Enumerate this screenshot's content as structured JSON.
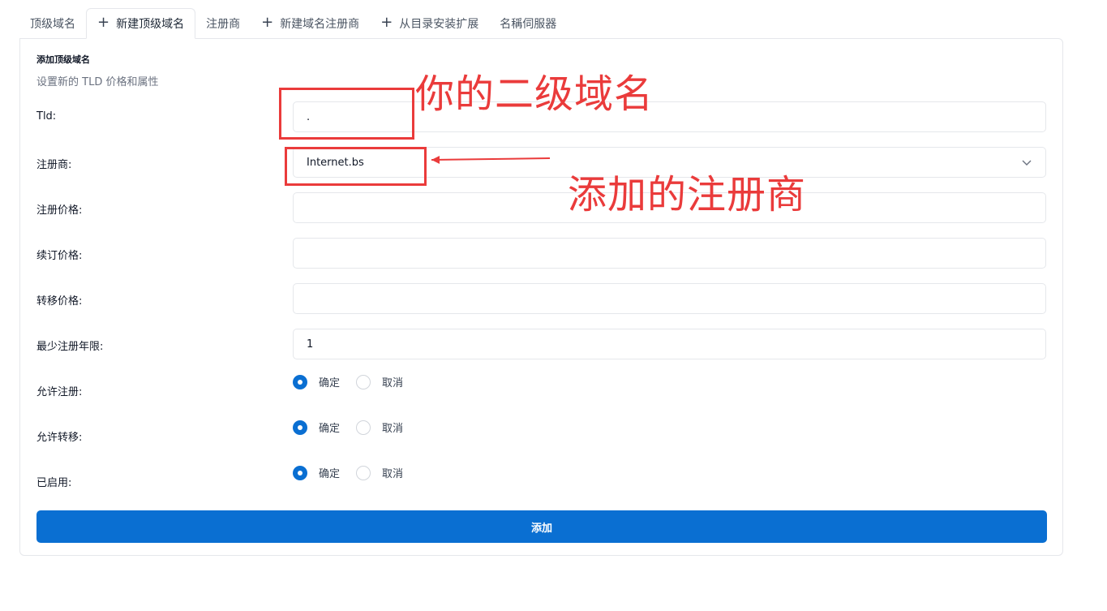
{
  "tabs": [
    {
      "label": "顶级域名",
      "icon": null
    },
    {
      "label": "新建顶级域名",
      "icon": "plus-icon"
    },
    {
      "label": "注册商",
      "icon": null
    },
    {
      "label": "新建域名注册商",
      "icon": "plus-icon"
    },
    {
      "label": "从目录安装扩展",
      "icon": "plus-icon"
    },
    {
      "label": "名稱伺服器",
      "icon": null
    }
  ],
  "form": {
    "title": "添加顶级域名",
    "subtitle": "设置新的 TLD 价格和属性",
    "tld": {
      "label": "Tld:",
      "value": "."
    },
    "registrar": {
      "label": "注册商:",
      "value": "Internet.bs"
    },
    "register_price": {
      "label": "注册价格:",
      "value": ""
    },
    "renew_price": {
      "label": "续订价格:",
      "value": ""
    },
    "transfer_price": {
      "label": "转移价格:",
      "value": ""
    },
    "min_years": {
      "label": "最少注册年限:",
      "value": "1"
    },
    "allow_register": {
      "label": "允许注册:",
      "yes": "确定",
      "no": "取消",
      "selected": "yes"
    },
    "allow_transfer": {
      "label": "允许转移:",
      "yes": "确定",
      "no": "取消",
      "selected": "yes"
    },
    "enabled": {
      "label": "已启用:",
      "yes": "确定",
      "no": "取消",
      "selected": "yes"
    },
    "submit_label": "添加"
  },
  "annotations": {
    "tld_note": "你的二级域名",
    "registrar_note": "添加的注册商",
    "color": "#ea3b3b"
  },
  "colors": {
    "primary": "#0a6fd2"
  }
}
